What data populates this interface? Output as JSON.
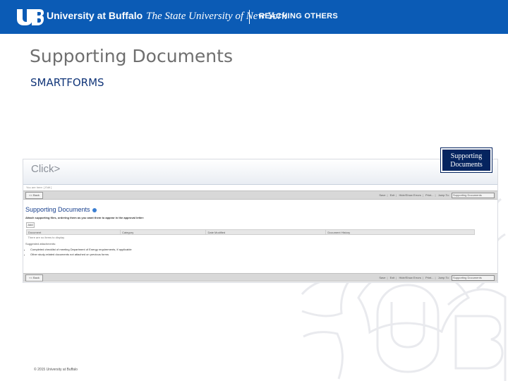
{
  "header": {
    "university": "University at Buffalo",
    "state_university": "The State University of New York",
    "tagline": "REACHING OTHERS",
    "colors": {
      "brand_blue": "#0b5bb5",
      "white": "#ffffff"
    }
  },
  "slide": {
    "title": "Supporting Documents",
    "subtitle": "SMARTFORMS",
    "callout": "Supporting Documents",
    "copyright": "© 2015 University at Buffalo"
  },
  "screenshot": {
    "click_logo": "Click",
    "click_logo_mark": ">",
    "breadcrumbs": "You are here: [ Edit ]",
    "toolbar": {
      "back": "<< Back",
      "save": "Save",
      "exit": "Exit",
      "hide_show_errors": "Hide/Show Errors",
      "print": "Print...",
      "jump_to": "Jump To:",
      "jump_value": "Supporting Documents"
    },
    "section": {
      "title": "Supporting Documents",
      "instructions": "Attach supporting files, ordering them as you want them to appear in the approval letter:",
      "add": "Add",
      "columns": [
        "Document",
        "Category",
        "Date Modified",
        "Document History"
      ],
      "empty_message": "There are no items to display",
      "suggested_label": "Suggested attachments:",
      "attachments": [
        "Completed checklist of meeting Department of Energy requirements, if applicable",
        "Other study-related documents not attached on previous forms"
      ]
    },
    "bottom_toolbar": {
      "back": "<< Back",
      "save": "Save",
      "exit": "Exit",
      "hide_show_errors": "Hide/Show Errors",
      "print": "Print...",
      "jump_to": "Jump To:",
      "jump_value": "Supporting Documents"
    }
  }
}
